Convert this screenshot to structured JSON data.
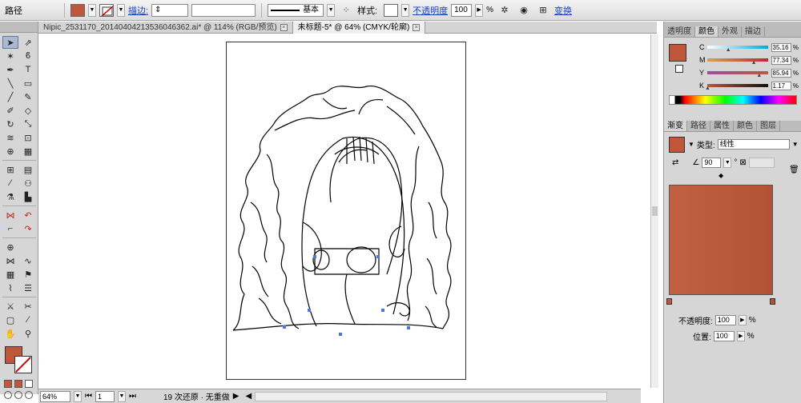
{
  "control_bar": {
    "object_label": "路径",
    "fill_color": "#c0573a",
    "stroke_label": "描边:",
    "stroke_style_label": "基本",
    "style_label": "样式:",
    "opacity_label": "不透明度",
    "opacity_value": "100",
    "opacity_unit": "%",
    "transform_label": "变换"
  },
  "tabs": [
    {
      "label": "Nipic_2531170_20140404213536046362.ai* @ 114% (RGB/预览)"
    },
    {
      "label": "未标题-5* @ 64% (CMYK/轮廓)"
    }
  ],
  "status_bar": {
    "zoom": "64%",
    "page": "1",
    "history_text": "19 次还原 · 无重做"
  },
  "color_panel": {
    "tabs": [
      "透明度",
      "颜色",
      "外观",
      "描边"
    ],
    "active_tab": "颜色",
    "swatch_color": "#c0573a",
    "channels": [
      {
        "letter": "C",
        "value": "35.16",
        "unit": "%",
        "fraction": 0.35
      },
      {
        "letter": "M",
        "value": "77.34",
        "unit": "%",
        "fraction": 0.77
      },
      {
        "letter": "Y",
        "value": "85.94",
        "unit": "%",
        "fraction": 0.86
      },
      {
        "letter": "K",
        "value": "1.17",
        "unit": "%",
        "fraction": 0.01
      }
    ]
  },
  "gradient_panel": {
    "tabs": [
      "渐变",
      "路径",
      "属性",
      "颜色",
      "图层"
    ],
    "active_tab": "渐变",
    "type_label": "类型:",
    "type_value": "线性",
    "angle_value": "90",
    "angle_unit": "°",
    "gradient_start": "#c16043",
    "gradient_end": "#b45235",
    "opacity_label": "不透明度:",
    "opacity_value": "100",
    "position_label": "位置:",
    "position_value": "100",
    "unit": "%"
  },
  "colors": {
    "accent_fill": "#c0573a",
    "link": "#1a3fc2"
  }
}
